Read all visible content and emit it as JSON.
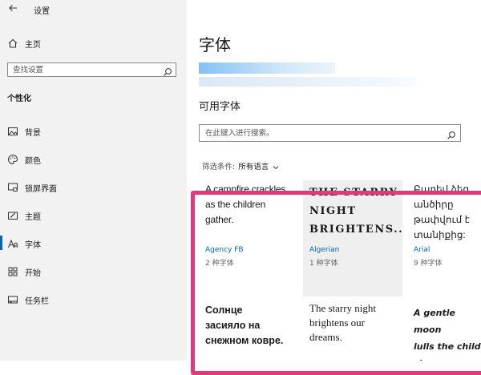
{
  "window": {
    "title": "设置"
  },
  "sidebar": {
    "home_label": "主页",
    "search_placeholder": "查找设置",
    "section_heading": "个性化",
    "items": [
      {
        "label": "背景",
        "icon": "image-icon"
      },
      {
        "label": "颜色",
        "icon": "palette-icon"
      },
      {
        "label": "锁屏界面",
        "icon": "lock-screen-icon"
      },
      {
        "label": "主题",
        "icon": "theme-icon"
      },
      {
        "label": "字体",
        "icon": "font-icon",
        "active": true
      },
      {
        "label": "开始",
        "icon": "start-icon"
      },
      {
        "label": "任务栏",
        "icon": "taskbar-icon"
      }
    ]
  },
  "main": {
    "title": "字体",
    "available_fonts_title": "可用字体",
    "search_placeholder": "在此键入进行搜索。",
    "filter_label": "筛选条件:",
    "filter_value": "所有语言",
    "fonts": [
      {
        "sample": "A campfire crackles\nas the children\ngather.",
        "name": "Agency FB",
        "count": "2 种字体"
      },
      {
        "sample": "THE STARRY\nNIGHT\nBRIGHTENS...",
        "name": "Algerian",
        "count": "1 种字体"
      },
      {
        "sample": "Բարեվ ձեզ\nանծիրը\nթափվում է\nտանիքից:",
        "name": "Arial",
        "count": "9 种字体"
      },
      {
        "sample": "Солнце\nзасияло на\nснежном ковре.",
        "name": "",
        "count": ""
      },
      {
        "sample": "The starry night\nbrightens our\ndreams.",
        "name": "",
        "count": ""
      },
      {
        "sample": "A gentle moon\nlulls the child\nsleep.",
        "name": "",
        "count": ""
      }
    ]
  },
  "colors": {
    "accent": "#0067c0",
    "highlight": "#e03a7b",
    "sidebar_bg": "#f2f2f2"
  }
}
